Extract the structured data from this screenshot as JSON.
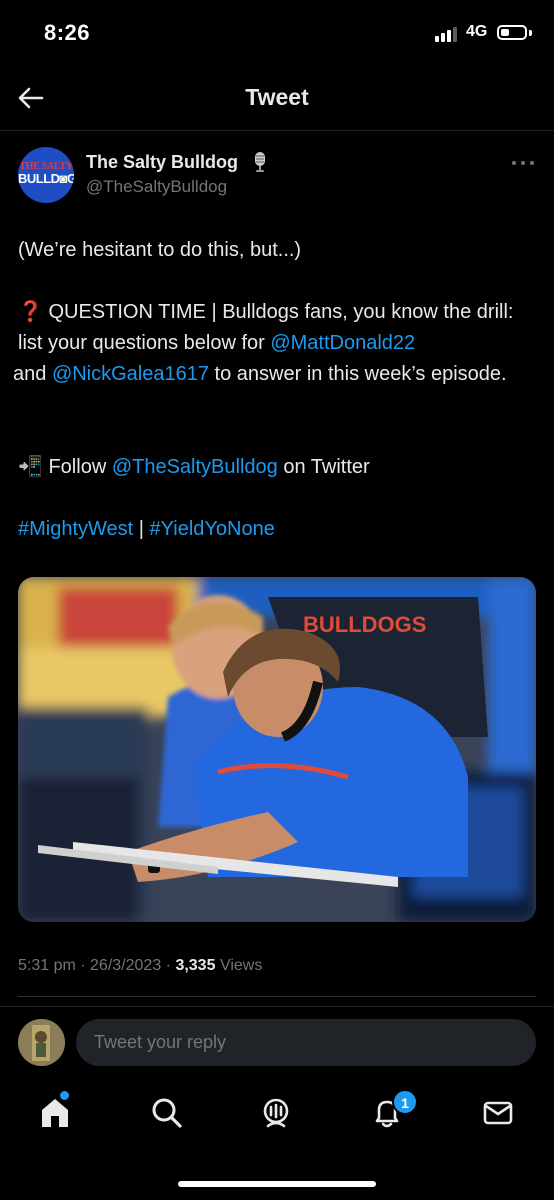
{
  "status_bar": {
    "time": "8:26",
    "network": "4G",
    "battery_level": 0.35
  },
  "header": {
    "title": "Tweet",
    "back_icon": "arrow-left-icon"
  },
  "author": {
    "name": "The Salty Bulldog",
    "handle": "@TheSaltyBulldog",
    "avatar_line1": "THE SALTY",
    "avatar_line2": "BULLD◙G",
    "badge_icon": "microphone-icon"
  },
  "tweet": {
    "line_intro": "(We’re hesitant to do this, but...)",
    "question_emoji": "❓",
    "question_text_a": " QUESTION TIME | Bulldogs fans, you know the drill: list your questions below for ",
    "mention_1": "@MattDonald22",
    "question_text_b": " and ",
    "mention_2": "@NickGalea1617",
    "question_text_c": " to answer in this week’s episode.",
    "follow_emoji": "📲",
    "follow_text_a": " Follow ",
    "mention_3": "@TheSaltyBulldog",
    "follow_text_b": " on Twitter",
    "hashtag_1": "#MightyWest",
    "hashtag_sep": " | ",
    "hashtag_2": "#YieldYoNone",
    "image_text": "BULLDOGS"
  },
  "meta": {
    "time": "5:31 pm",
    "sep": " · ",
    "date": "26/3/2023",
    "views_count": "3,335",
    "views_label": "Views"
  },
  "reply": {
    "placeholder": "Tweet your reply"
  },
  "bottom_nav": {
    "items": [
      "home-icon",
      "search-icon",
      "spaces-icon",
      "notifications-icon",
      "messages-icon"
    ],
    "notifications_badge": "1"
  },
  "colors": {
    "background": "#000000",
    "text": "#e7e9ea",
    "secondary": "#71767b",
    "link": "#1d9bf0"
  }
}
